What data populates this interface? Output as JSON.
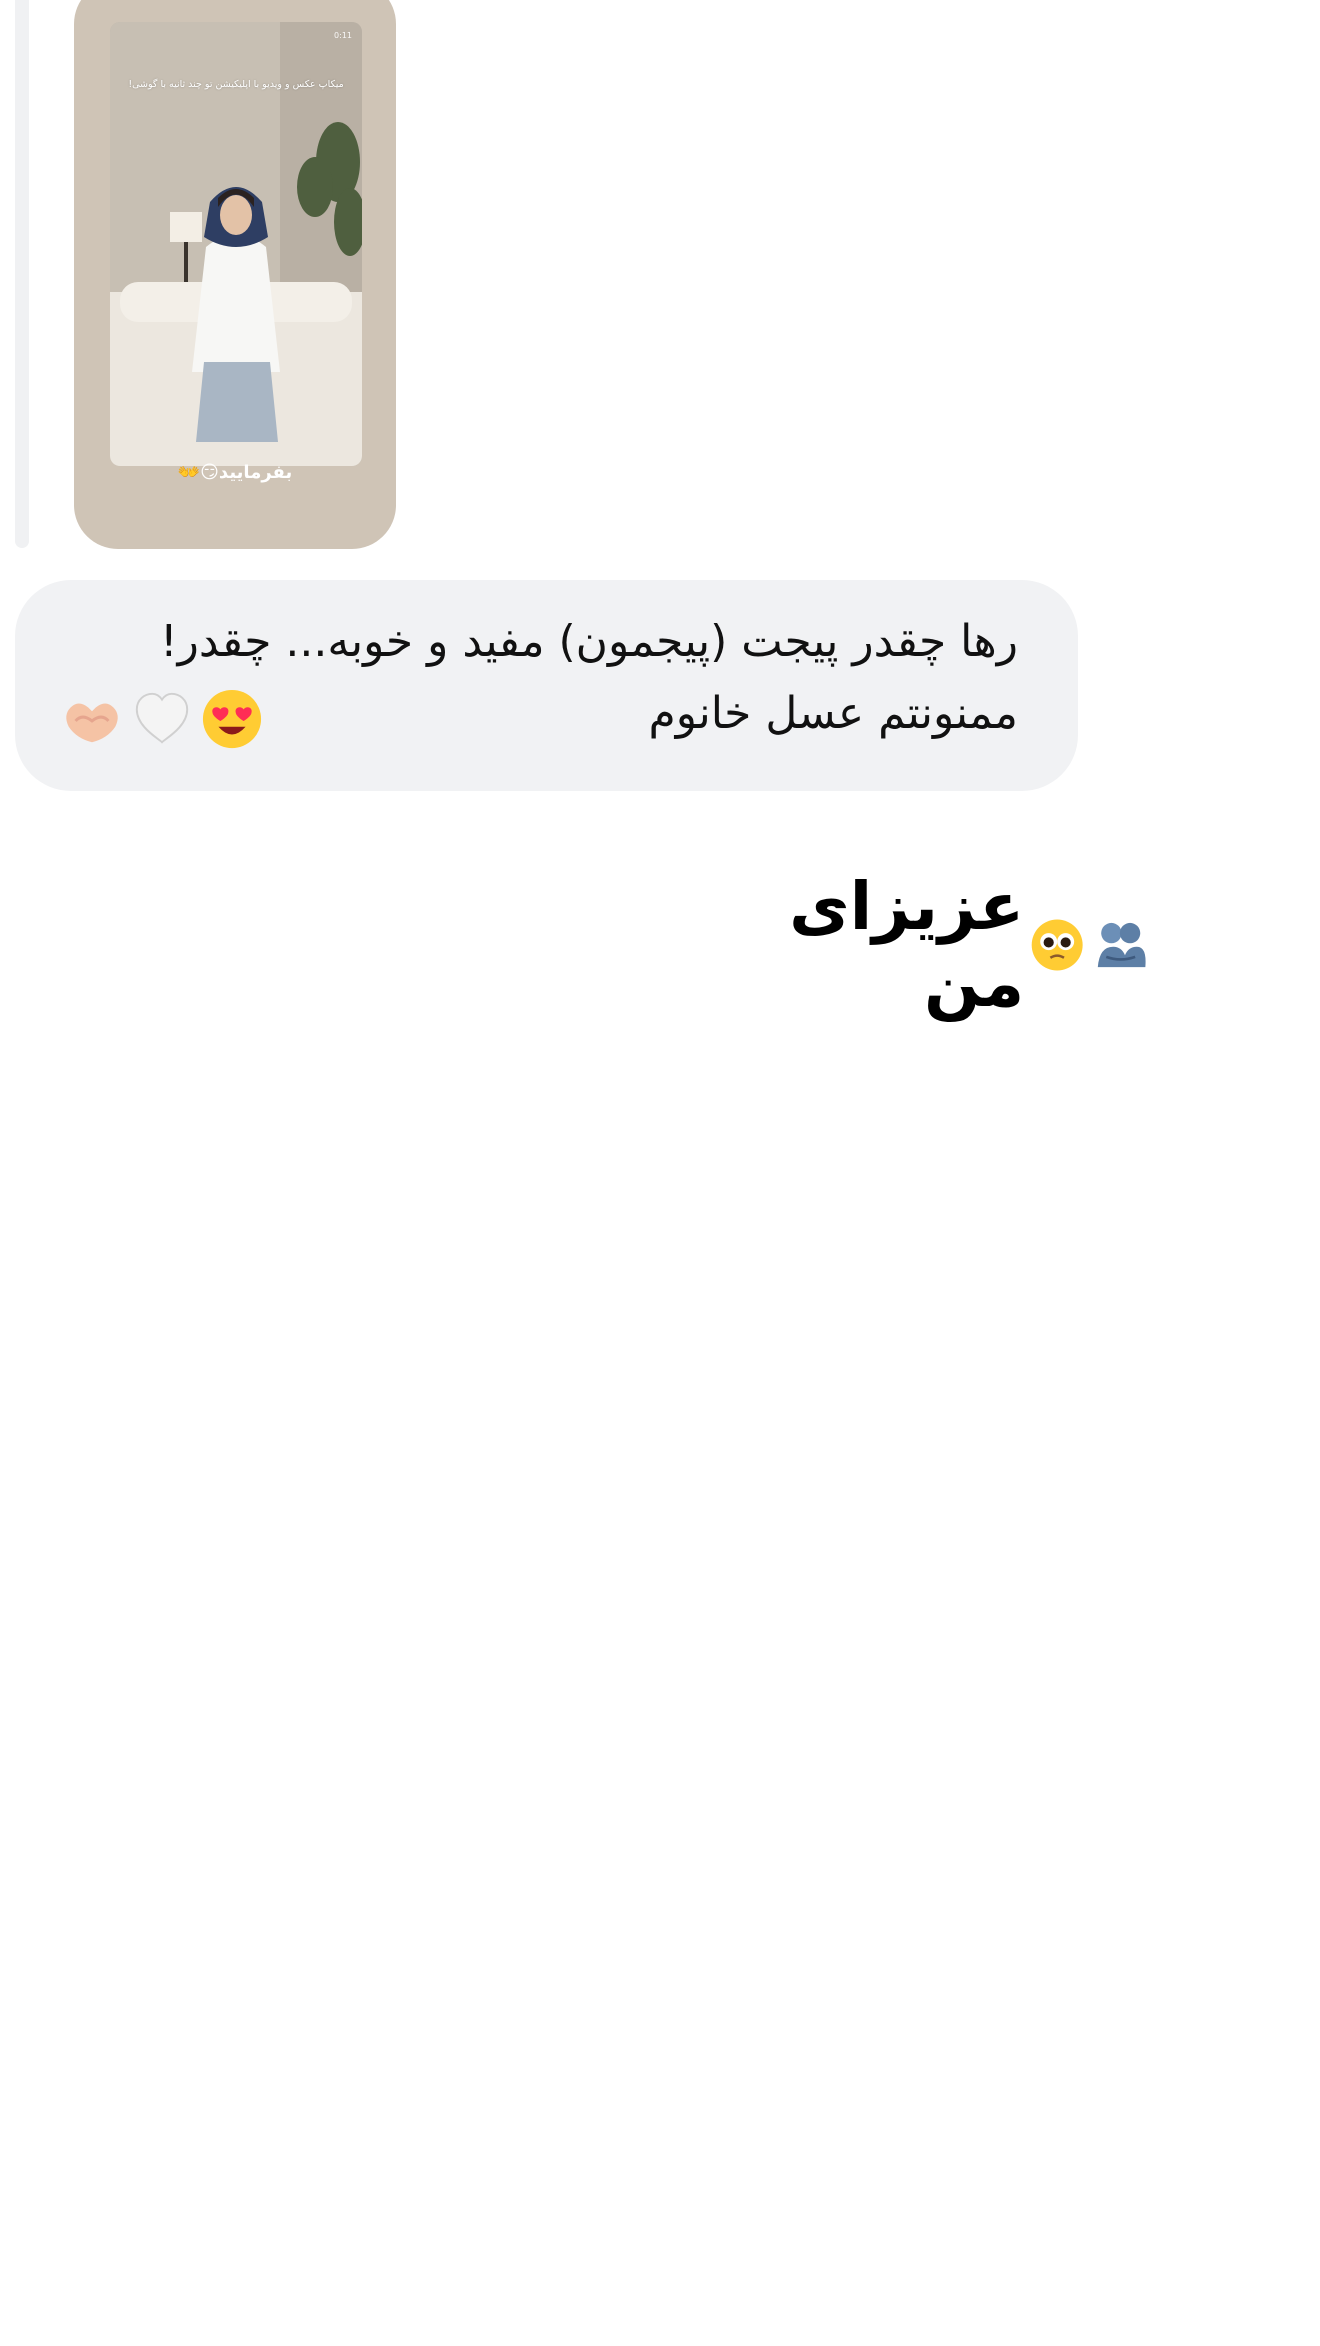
{
  "story_preview": {
    "status_left": "",
    "status_time": "0:11",
    "caption": "میکاپ عکس و ویدیو با اپلیکیشن تو چند ثانیه با گوشی!",
    "bottom_text": "بفرمایید😏👐"
  },
  "message": {
    "text": "رها چقدر پیجت (پیجمون) مفید و خوبه... چقدر! ممنونتم عسل خانوم",
    "emojis": [
      "heart-eyes",
      "white-heart",
      "heart-hands"
    ]
  },
  "reply_sticker": {
    "text": "عزیزای من",
    "emojis": [
      "pleading-face",
      "people-hugging"
    ]
  },
  "colors": {
    "bubble": "#f1f2f4",
    "story_card": "#cfc4b6",
    "text": "#111111"
  }
}
